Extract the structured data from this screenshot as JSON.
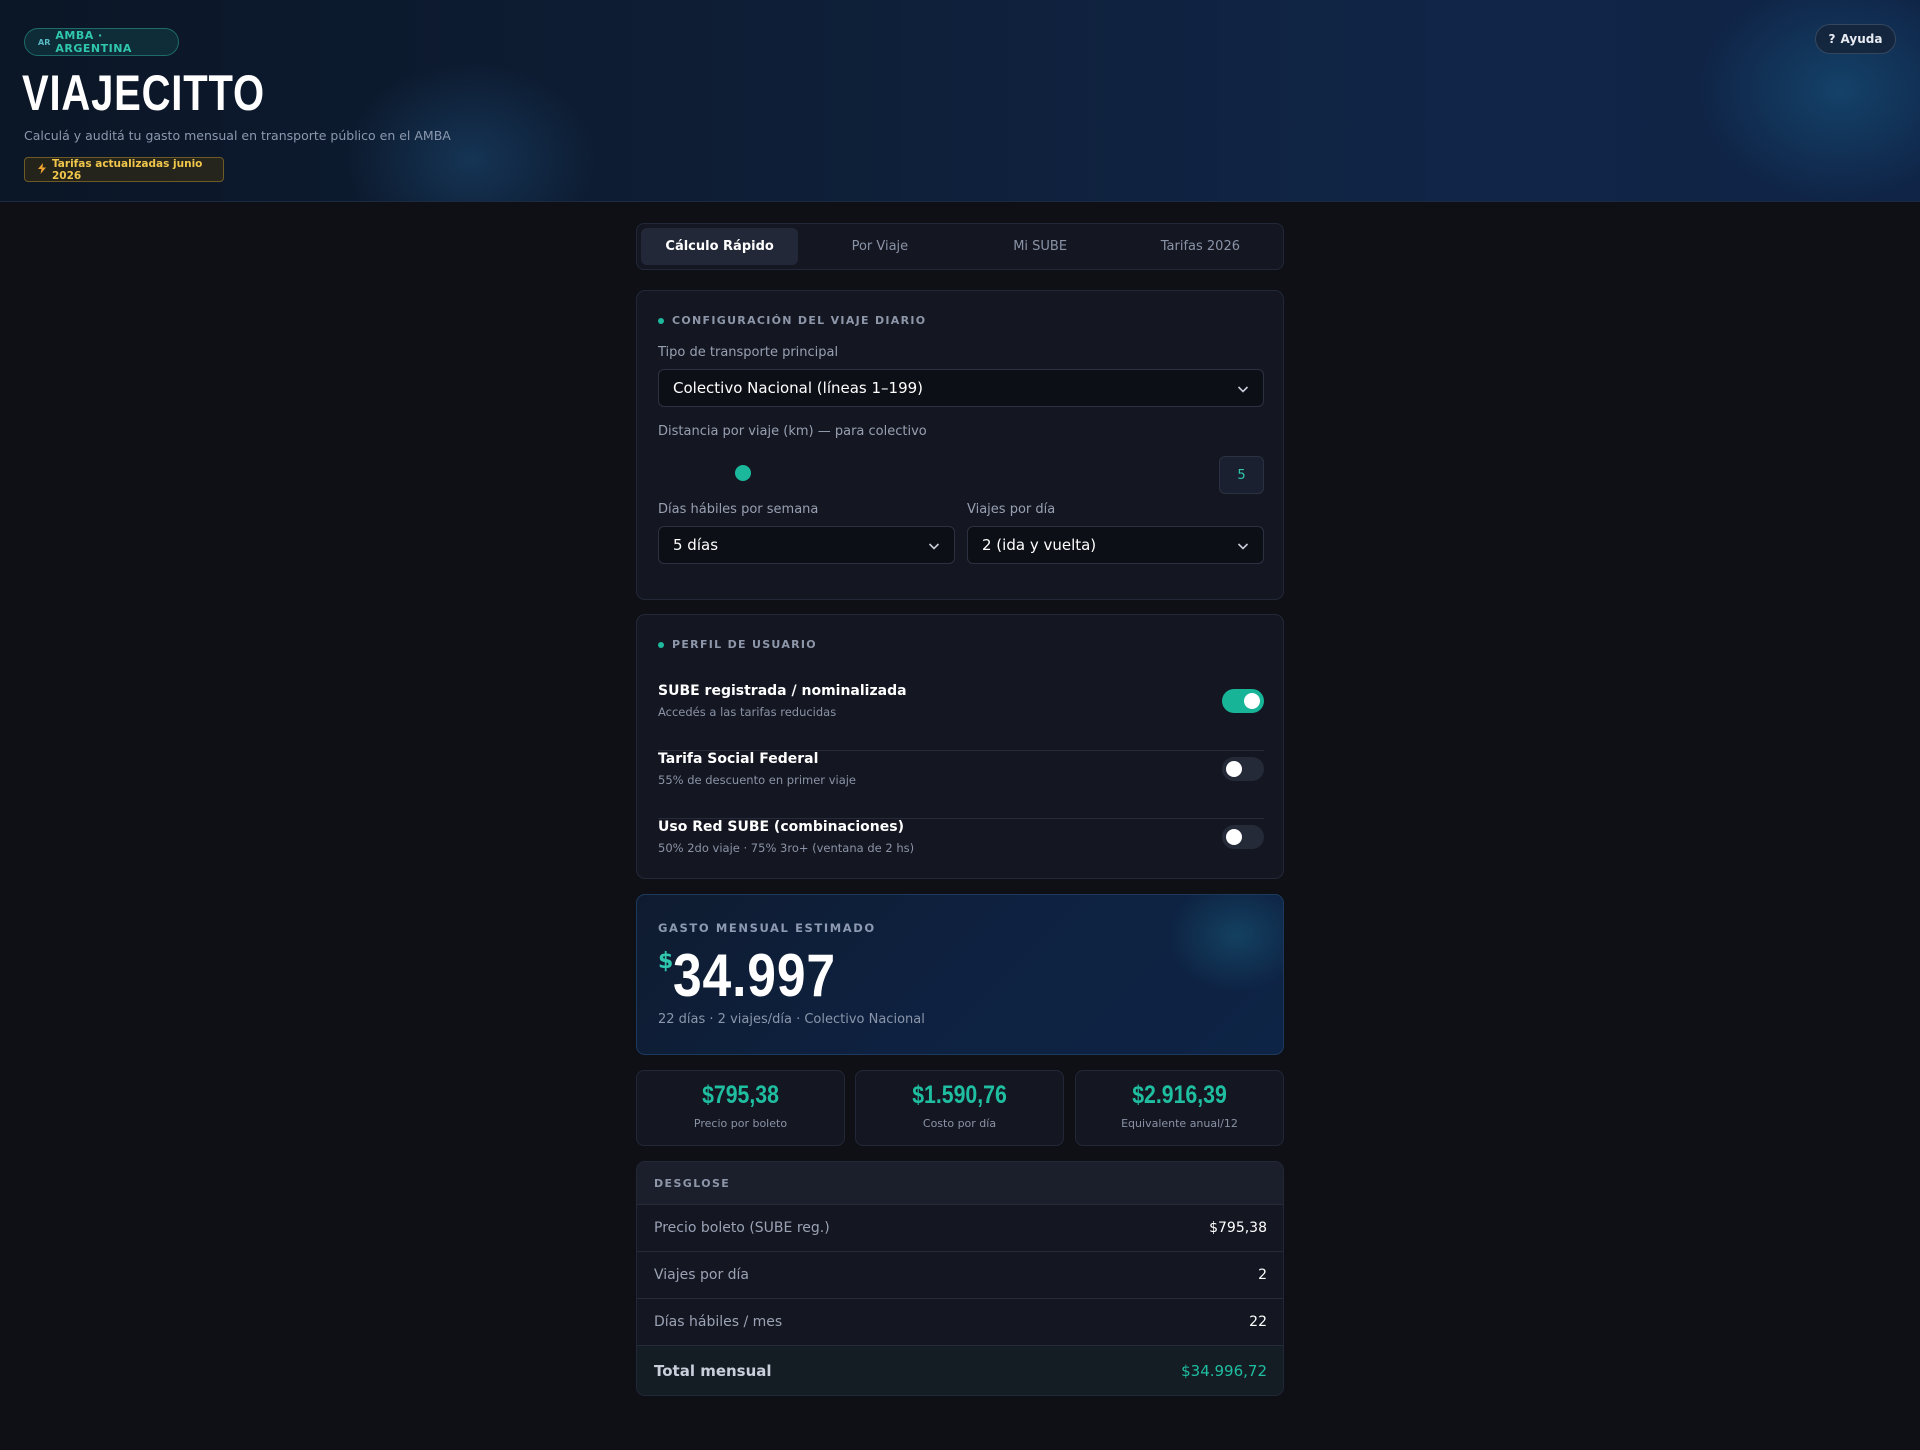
{
  "header": {
    "region_flag": "AR",
    "region_label": "AMBA · ARGENTINA",
    "brand": "VIAJECITTO",
    "subtitle": "Calculá y auditá tu gasto mensual en transporte público en el AMBA",
    "tariff_badge": "Tarifas actualizadas junio 2026",
    "help_label": "Ayuda"
  },
  "tabs": [
    {
      "label": "Cálculo Rápido",
      "active": true
    },
    {
      "label": "Por Viaje",
      "active": false
    },
    {
      "label": "Mi SUBE",
      "active": false
    },
    {
      "label": "Tarifas 2026",
      "active": false
    }
  ],
  "config": {
    "section_title": "CONFIGURACIÓN DEL VIAJE DIARIO",
    "transport_label": "Tipo de transporte principal",
    "transport_value": "Colectivo Nacional (líneas 1–199)",
    "distance_label": "Distancia por viaje (km) — para colectivo",
    "distance_value": "5",
    "days_label": "Días hábiles por semana",
    "days_value": "5 días",
    "trips_label": "Viajes por día",
    "trips_value": "2 (ida y vuelta)"
  },
  "profile": {
    "section_title": "PERFIL DE USUARIO",
    "rows": [
      {
        "title": "SUBE registrada / nominalizada",
        "desc": "Accedés a las tarifas reducidas",
        "on": true
      },
      {
        "title": "Tarifa Social Federal",
        "desc": "55% de descuento en primer viaje",
        "on": false
      },
      {
        "title": "Uso Red SUBE (combinaciones)",
        "desc": "50% 2do viaje · 75% 3ro+ (ventana de 2 hs)",
        "on": false
      }
    ]
  },
  "result": {
    "label": "GASTO MENSUAL ESTIMADO",
    "currency": "$",
    "value": "34.997",
    "desc": "22 días · 2 viajes/día · Colectivo Nacional"
  },
  "stats": [
    {
      "value": "$795,38",
      "label": "Precio por boleto"
    },
    {
      "value": "$1.590,76",
      "label": "Costo por día"
    },
    {
      "value": "$2.916,39",
      "label": "Equivalente anual/12"
    }
  ],
  "breakdown": {
    "title": "DESGLOSE",
    "rows": [
      {
        "key": "Precio boleto (SUBE reg.)",
        "value": "$795,38"
      },
      {
        "key": "Viajes por día",
        "value": "2"
      },
      {
        "key": "Días hábiles / mes",
        "value": "22"
      }
    ],
    "total_key": "Total mensual",
    "total_value": "$34.996,72"
  },
  "colors": {
    "accent": "#1fbea1",
    "background": "#0e1016",
    "card": "#141722",
    "badge_yellow": "#f0c64b"
  },
  "icons": {
    "help": "question-icon",
    "tariff": "lightning-icon",
    "select": "chevron-down-icon"
  }
}
